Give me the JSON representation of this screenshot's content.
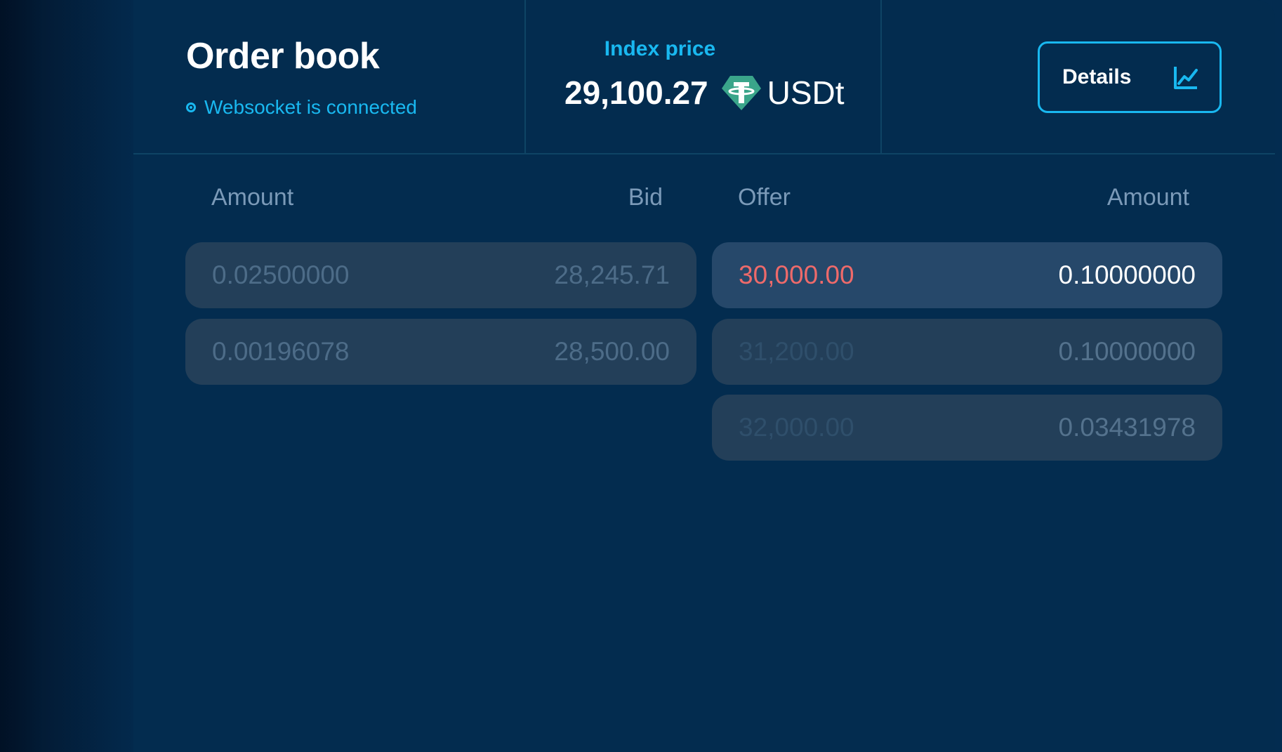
{
  "header": {
    "title": "Order book",
    "status_text": "Websocket is connected",
    "index_label": "Index price",
    "index_value": "29,100.27",
    "currency": "USDt",
    "currency_icon": "tether-icon",
    "details_label": "Details",
    "details_icon": "line-chart-icon"
  },
  "columns": {
    "bids": {
      "amount": "Amount",
      "price": "Bid"
    },
    "asks": {
      "price": "Offer",
      "amount": "Amount"
    }
  },
  "bids": [
    {
      "amount": "0.02500000",
      "price": "28,245.71"
    },
    {
      "amount": "0.00196078",
      "price": "28,500.00"
    }
  ],
  "asks": [
    {
      "price": "30,000.00",
      "amount": "0.10000000",
      "highlighted": true
    },
    {
      "price": "31,200.00",
      "amount": "0.10000000",
      "highlighted": false
    },
    {
      "price": "32,000.00",
      "amount": "0.03431978",
      "highlighted": false
    }
  ],
  "colors": {
    "accent": "#19b8f0",
    "ask_price": "#ee6a6a",
    "background": "#032c4f",
    "row": "#233f59"
  }
}
